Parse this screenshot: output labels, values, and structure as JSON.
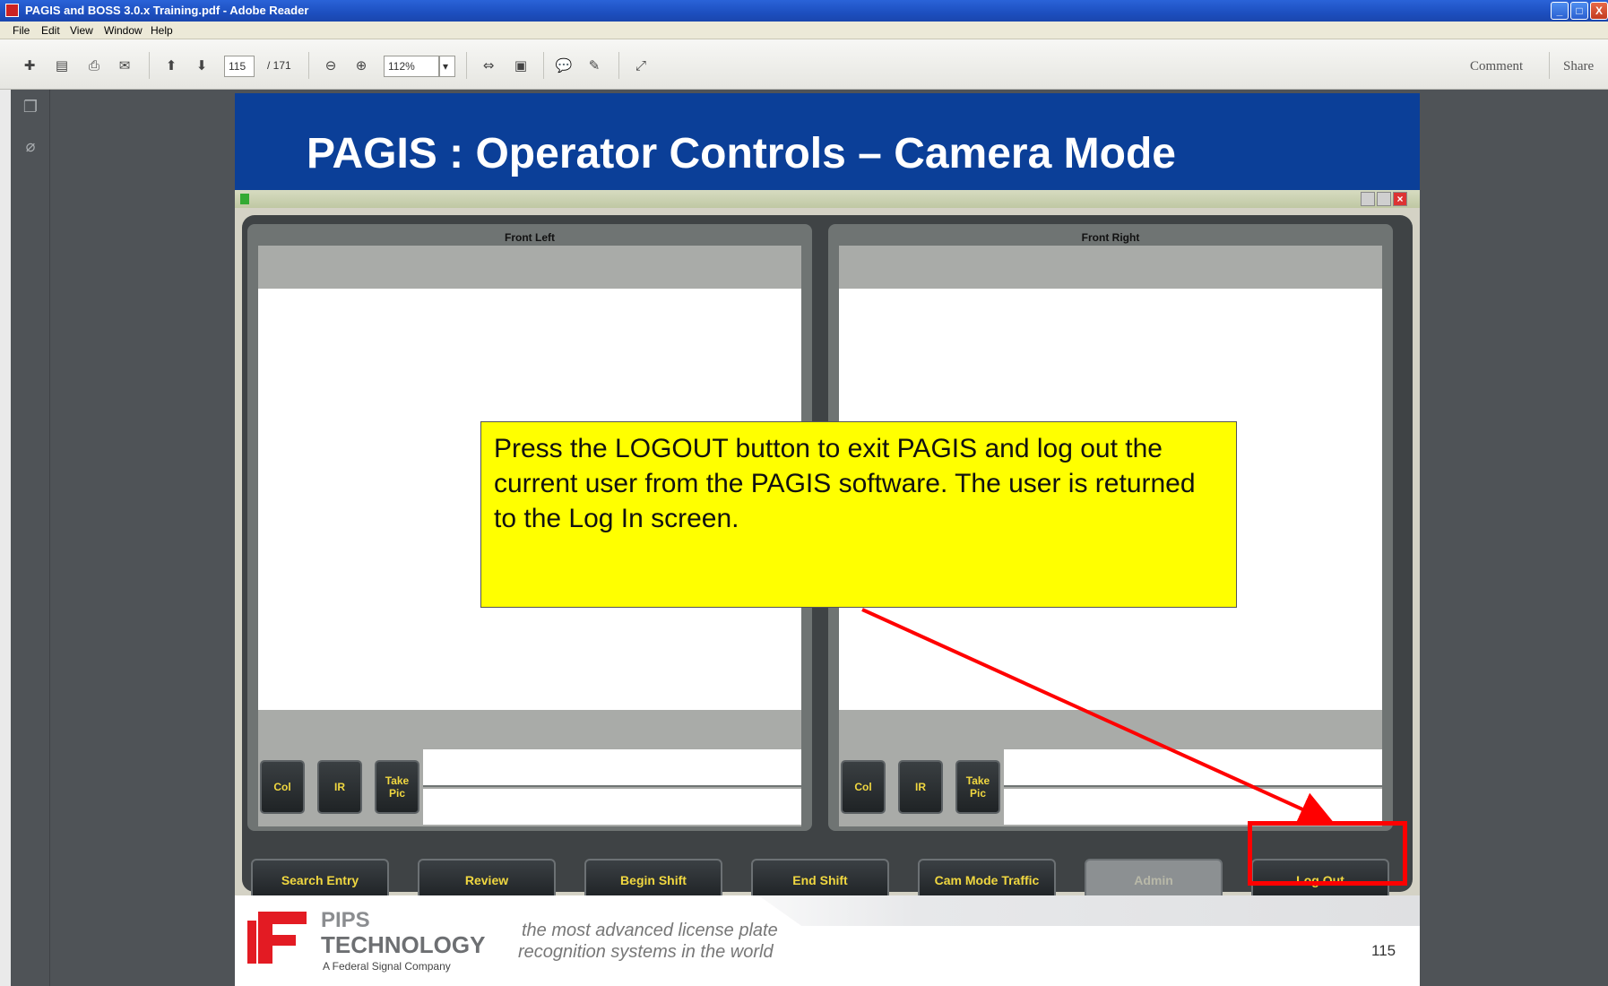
{
  "window": {
    "title": "PAGIS and BOSS 3.0.x Training.pdf - Adobe Reader",
    "controls": {
      "minimize": "_",
      "maximize": "□",
      "close": "X"
    }
  },
  "menubar": [
    "File",
    "Edit",
    "View",
    "Window",
    "Help"
  ],
  "toolbar": {
    "page_current": "115",
    "page_total": "/ 171",
    "zoom": "112%",
    "comment_label": "Comment",
    "share_label": "Share"
  },
  "slide": {
    "title": "PAGIS : Operator Controls – Camera Mode",
    "app_window": {
      "panels": [
        {
          "title": "Front Left",
          "buttons": [
            "Col",
            "IR",
            "Take Pic"
          ]
        },
        {
          "title": "Front Right",
          "buttons": [
            "Col",
            "IR",
            "Take Pic"
          ]
        }
      ],
      "bottom_buttons": [
        {
          "label": "Search Entry",
          "enabled": true
        },
        {
          "label": "Review",
          "enabled": true
        },
        {
          "label": "Begin Shift",
          "enabled": true
        },
        {
          "label": "End Shift",
          "enabled": true
        },
        {
          "label": "Cam Mode Traffic",
          "enabled": true
        },
        {
          "label": "Admin",
          "enabled": false
        },
        {
          "label": "Log Out",
          "enabled": true
        }
      ]
    },
    "callout": "Press the LOGOUT button to exit PAGIS and log out the current user from the PAGIS software.  The user is returned to the Log In screen.",
    "footer": {
      "company_line1": "PIPS",
      "company_line2": "TECHNOLOGY",
      "company_line3": "A Federal Signal Company",
      "tagline1": "the most advanced license plate",
      "tagline2": "recognition systems in the world",
      "page_number": "115"
    }
  },
  "colors": {
    "slide_header": "#0b3f98",
    "callout_bg": "#ffff00",
    "highlight": "#ff0000",
    "button_text": "#f0d740"
  }
}
